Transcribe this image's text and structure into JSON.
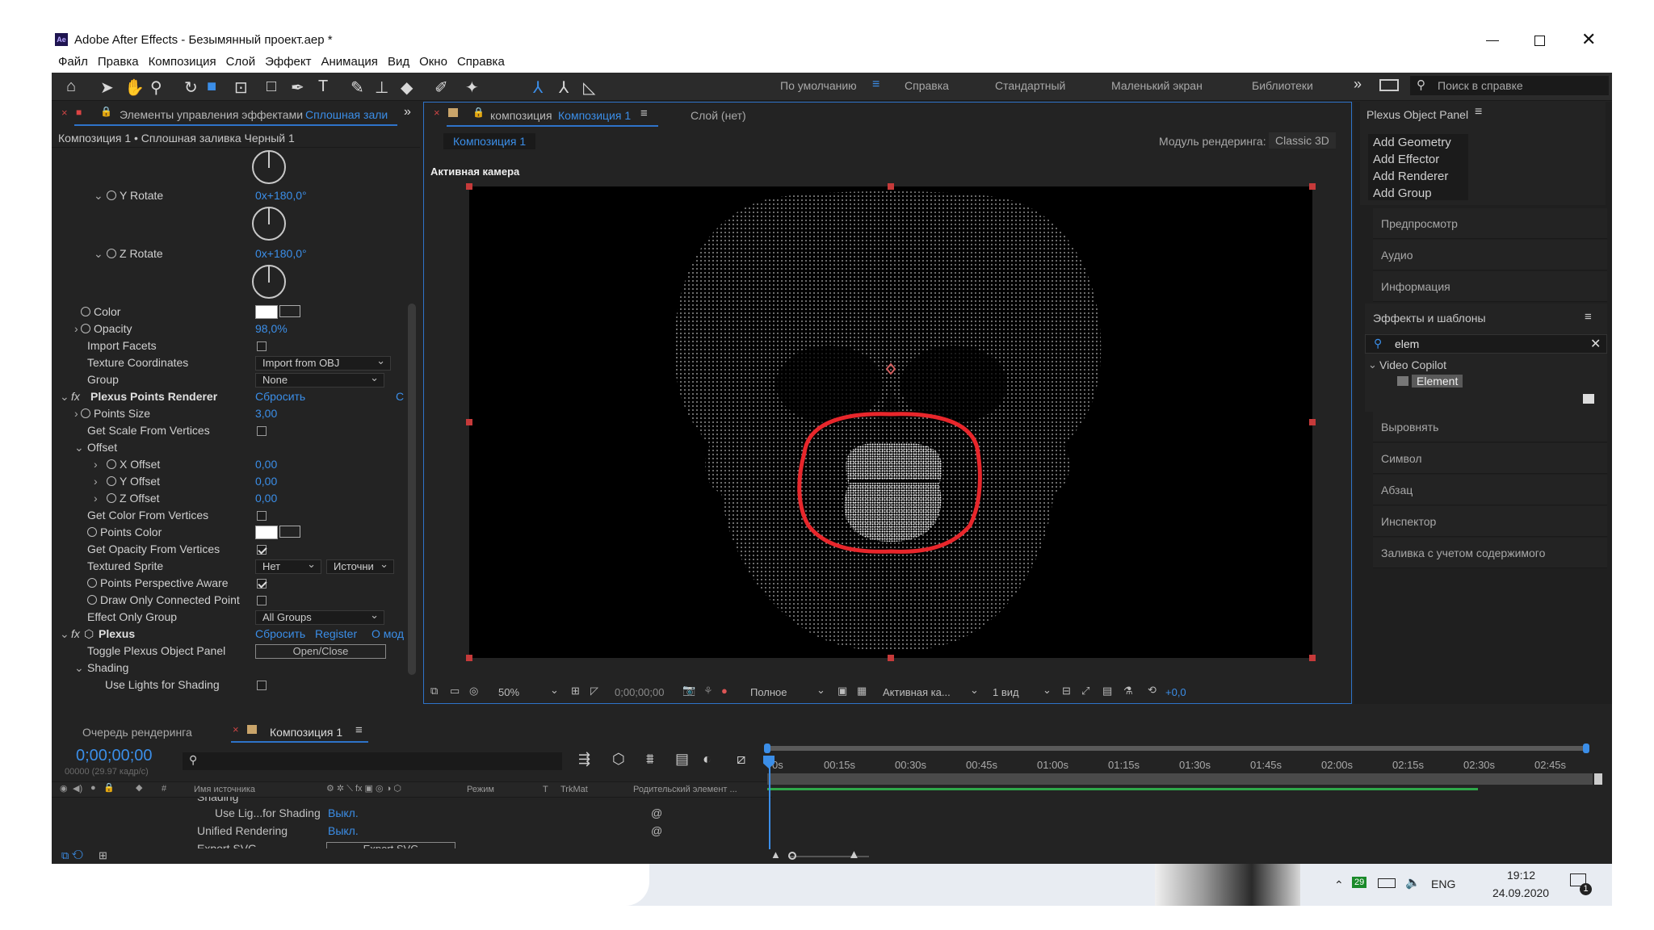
{
  "window": {
    "title": "Adobe After Effects - Безымянный проект.aep *",
    "app_icon": "Ae"
  },
  "menu": [
    "Файл",
    "Правка",
    "Композиция",
    "Слой",
    "Эффект",
    "Анимация",
    "Вид",
    "Окно",
    "Справка"
  ],
  "workspaces": {
    "active": "По умолчанию",
    "items": [
      "Справка",
      "Стандартный",
      "Маленький экран",
      "Библиотеки"
    ],
    "more": "»"
  },
  "search_help": {
    "placeholder": "Поиск в справке"
  },
  "effects_panel": {
    "tab_prefix": "Элементы управления эффектами",
    "tab_layer": "Сплошная зали",
    "breadcrumb": "Композиция 1 • Сплошная заливка Черный 1",
    "rows": {
      "y_rotate": {
        "label": "Y Rotate",
        "value": "0x+180,0°"
      },
      "z_rotate": {
        "label": "Z Rotate",
        "value": "0x+180,0°"
      },
      "color": {
        "label": "Color"
      },
      "opacity": {
        "label": "Opacity",
        "value": "98,0%"
      },
      "import_facets": {
        "label": "Import Facets"
      },
      "texture_coords": {
        "label": "Texture Coordinates",
        "value": "Import from OBJ"
      },
      "group": {
        "label": "Group",
        "value": "None"
      },
      "renderer": {
        "label": "Plexus Points Renderer",
        "reset": "Сбросить",
        "extra": "С"
      },
      "points_size": {
        "label": "Points Size",
        "value": "3,00"
      },
      "scale_from_vertices": {
        "label": "Get Scale From Vertices"
      },
      "offset": {
        "label": "Offset"
      },
      "x_offset": {
        "label": "X Offset",
        "value": "0,00"
      },
      "y_offset": {
        "label": "Y Offset",
        "value": "0,00"
      },
      "z_offset": {
        "label": "Z Offset",
        "value": "0,00"
      },
      "color_from_vertices": {
        "label": "Get Color From Vertices"
      },
      "points_color": {
        "label": "Points Color"
      },
      "opacity_from_vertices": {
        "label": "Get Opacity From Vertices"
      },
      "textured_sprite": {
        "label": "Textured Sprite",
        "value": "Нет",
        "value2": "Источни"
      },
      "perspective_aware": {
        "label": "Points Perspective Aware"
      },
      "draw_only_connected": {
        "label": "Draw Only Connected Point"
      },
      "effect_only_group": {
        "label": "Effect Only Group",
        "value": "All Groups"
      },
      "plexus": {
        "label": "Plexus",
        "reset": "Сбросить",
        "register": "Register",
        "about": "О мод"
      },
      "toggle_panel": {
        "label": "Toggle Plexus Object Panel",
        "button": "Open/Close"
      },
      "shading": {
        "label": "Shading"
      },
      "use_lights": {
        "label": "Use Lights for Shading"
      }
    }
  },
  "comp_panel": {
    "tab_prefix": "композиция",
    "tab_name": "Композиция 1",
    "layer_tab": "Слой (нет)",
    "sub_tab": "Композиция 1",
    "renderer_label": "Модуль рендеринга:",
    "renderer_value": "Classic 3D",
    "camera_label": "Активная камера",
    "footer": {
      "zoom": "50%",
      "timecode": "0;00;00;00",
      "quality": "Полное",
      "camera": "Активная ка...",
      "views": "1 вид",
      "exposure": "+0,0"
    }
  },
  "right_panel": {
    "plexus_title": "Plexus Object Panel",
    "plexus_items": [
      "Add Geometry",
      "Add Effector",
      "Add Renderer",
      "Add Group"
    ],
    "sections_top": [
      "Предпросмотр",
      "Аудио",
      "Информация"
    ],
    "effects_title": "Эффекты и шаблоны",
    "search_value": "elem",
    "tree_folder": "Video Copilot",
    "tree_item": "Element",
    "sections_bottom": [
      "Выровнять",
      "Символ",
      "Абзац",
      "Инспектор",
      "Заливка с учетом содержимого"
    ]
  },
  "timeline": {
    "tab_render": "Очередь рендеринга",
    "tab_comp": "Композиция 1",
    "timecode": "0;00;00;00",
    "fps": "00000 (29.97 кадр/с)",
    "col_source": "Имя источника",
    "col_mode": "Режим",
    "col_t": "T",
    "col_trkmat": "TrkMat",
    "col_parent": "Родительский элемент ...",
    "ticks": [
      "0s",
      "00:15s",
      "00:30s",
      "00:45s",
      "01:00s",
      "01:15s",
      "01:30s",
      "01:45s",
      "02:00s",
      "02:15s",
      "02:30s",
      "02:45s"
    ],
    "rows": [
      {
        "name": "Shading",
        "value": ""
      },
      {
        "name": "Use Lig...for Shading",
        "value": "Выкл."
      },
      {
        "name": "Unified Rendering",
        "value": "Выкл."
      },
      {
        "name": "Export SVG",
        "value": "Export SVG"
      }
    ]
  },
  "taskbar": {
    "badge": "29",
    "lang": "ENG",
    "time": "19:12",
    "date": "24.09.2020",
    "notif": "1"
  }
}
